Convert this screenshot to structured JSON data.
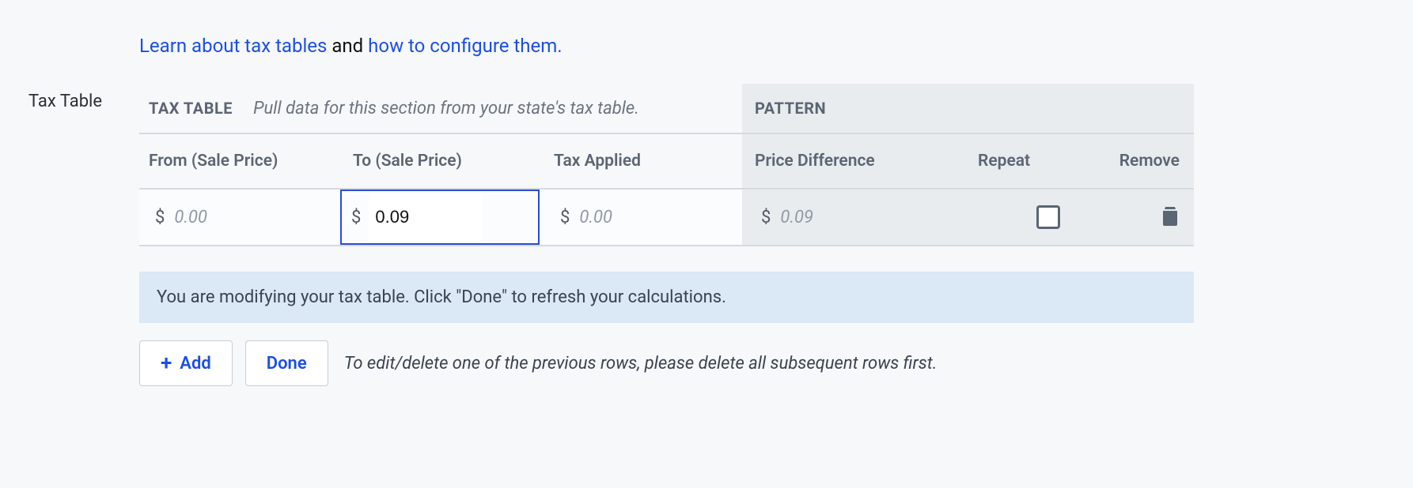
{
  "links": {
    "learn": "Learn about tax tables",
    "and": " and ",
    "configure": "how to configure them."
  },
  "section_label": "Tax Table",
  "header": {
    "tax_table_title": "TAX TABLE",
    "tax_table_desc": "Pull data for this section from your state's tax table.",
    "pattern_title": "PATTERN"
  },
  "columns": {
    "from": "From (Sale Price)",
    "to": "To (Sale Price)",
    "tax": "Tax Applied",
    "diff": "Price Difference",
    "repeat": "Repeat",
    "remove": "Remove"
  },
  "row": {
    "currency": "$",
    "from_placeholder": "0.00",
    "to_value": "0.09",
    "tax_placeholder": "0.00",
    "diff_placeholder": "0.09"
  },
  "info": "You are modifying your tax table. Click \"Done\" to refresh your calculations.",
  "buttons": {
    "add": "Add",
    "done": "Done"
  },
  "hint": "To edit/delete one of the previous rows, please delete all subsequent rows first."
}
